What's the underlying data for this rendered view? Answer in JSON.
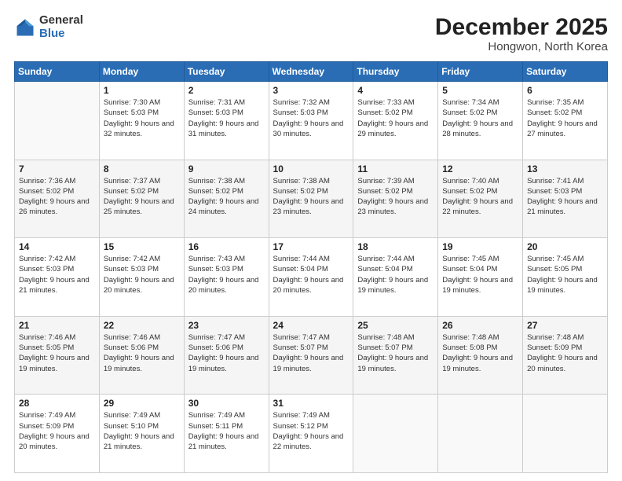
{
  "header": {
    "logo": {
      "general": "General",
      "blue": "Blue"
    },
    "month": "December 2025",
    "location": "Hongwon, North Korea"
  },
  "weekdays": [
    "Sunday",
    "Monday",
    "Tuesday",
    "Wednesday",
    "Thursday",
    "Friday",
    "Saturday"
  ],
  "weeks": [
    [
      {
        "day": "",
        "sunrise": "",
        "sunset": "",
        "daylight": ""
      },
      {
        "day": "1",
        "sunrise": "Sunrise: 7:30 AM",
        "sunset": "Sunset: 5:03 PM",
        "daylight": "Daylight: 9 hours and 32 minutes."
      },
      {
        "day": "2",
        "sunrise": "Sunrise: 7:31 AM",
        "sunset": "Sunset: 5:03 PM",
        "daylight": "Daylight: 9 hours and 31 minutes."
      },
      {
        "day": "3",
        "sunrise": "Sunrise: 7:32 AM",
        "sunset": "Sunset: 5:03 PM",
        "daylight": "Daylight: 9 hours and 30 minutes."
      },
      {
        "day": "4",
        "sunrise": "Sunrise: 7:33 AM",
        "sunset": "Sunset: 5:02 PM",
        "daylight": "Daylight: 9 hours and 29 minutes."
      },
      {
        "day": "5",
        "sunrise": "Sunrise: 7:34 AM",
        "sunset": "Sunset: 5:02 PM",
        "daylight": "Daylight: 9 hours and 28 minutes."
      },
      {
        "day": "6",
        "sunrise": "Sunrise: 7:35 AM",
        "sunset": "Sunset: 5:02 PM",
        "daylight": "Daylight: 9 hours and 27 minutes."
      }
    ],
    [
      {
        "day": "7",
        "sunrise": "Sunrise: 7:36 AM",
        "sunset": "Sunset: 5:02 PM",
        "daylight": "Daylight: 9 hours and 26 minutes."
      },
      {
        "day": "8",
        "sunrise": "Sunrise: 7:37 AM",
        "sunset": "Sunset: 5:02 PM",
        "daylight": "Daylight: 9 hours and 25 minutes."
      },
      {
        "day": "9",
        "sunrise": "Sunrise: 7:38 AM",
        "sunset": "Sunset: 5:02 PM",
        "daylight": "Daylight: 9 hours and 24 minutes."
      },
      {
        "day": "10",
        "sunrise": "Sunrise: 7:38 AM",
        "sunset": "Sunset: 5:02 PM",
        "daylight": "Daylight: 9 hours and 23 minutes."
      },
      {
        "day": "11",
        "sunrise": "Sunrise: 7:39 AM",
        "sunset": "Sunset: 5:02 PM",
        "daylight": "Daylight: 9 hours and 23 minutes."
      },
      {
        "day": "12",
        "sunrise": "Sunrise: 7:40 AM",
        "sunset": "Sunset: 5:02 PM",
        "daylight": "Daylight: 9 hours and 22 minutes."
      },
      {
        "day": "13",
        "sunrise": "Sunrise: 7:41 AM",
        "sunset": "Sunset: 5:03 PM",
        "daylight": "Daylight: 9 hours and 21 minutes."
      }
    ],
    [
      {
        "day": "14",
        "sunrise": "Sunrise: 7:42 AM",
        "sunset": "Sunset: 5:03 PM",
        "daylight": "Daylight: 9 hours and 21 minutes."
      },
      {
        "day": "15",
        "sunrise": "Sunrise: 7:42 AM",
        "sunset": "Sunset: 5:03 PM",
        "daylight": "Daylight: 9 hours and 20 minutes."
      },
      {
        "day": "16",
        "sunrise": "Sunrise: 7:43 AM",
        "sunset": "Sunset: 5:03 PM",
        "daylight": "Daylight: 9 hours and 20 minutes."
      },
      {
        "day": "17",
        "sunrise": "Sunrise: 7:44 AM",
        "sunset": "Sunset: 5:04 PM",
        "daylight": "Daylight: 9 hours and 20 minutes."
      },
      {
        "day": "18",
        "sunrise": "Sunrise: 7:44 AM",
        "sunset": "Sunset: 5:04 PM",
        "daylight": "Daylight: 9 hours and 19 minutes."
      },
      {
        "day": "19",
        "sunrise": "Sunrise: 7:45 AM",
        "sunset": "Sunset: 5:04 PM",
        "daylight": "Daylight: 9 hours and 19 minutes."
      },
      {
        "day": "20",
        "sunrise": "Sunrise: 7:45 AM",
        "sunset": "Sunset: 5:05 PM",
        "daylight": "Daylight: 9 hours and 19 minutes."
      }
    ],
    [
      {
        "day": "21",
        "sunrise": "Sunrise: 7:46 AM",
        "sunset": "Sunset: 5:05 PM",
        "daylight": "Daylight: 9 hours and 19 minutes."
      },
      {
        "day": "22",
        "sunrise": "Sunrise: 7:46 AM",
        "sunset": "Sunset: 5:06 PM",
        "daylight": "Daylight: 9 hours and 19 minutes."
      },
      {
        "day": "23",
        "sunrise": "Sunrise: 7:47 AM",
        "sunset": "Sunset: 5:06 PM",
        "daylight": "Daylight: 9 hours and 19 minutes."
      },
      {
        "day": "24",
        "sunrise": "Sunrise: 7:47 AM",
        "sunset": "Sunset: 5:07 PM",
        "daylight": "Daylight: 9 hours and 19 minutes."
      },
      {
        "day": "25",
        "sunrise": "Sunrise: 7:48 AM",
        "sunset": "Sunset: 5:07 PM",
        "daylight": "Daylight: 9 hours and 19 minutes."
      },
      {
        "day": "26",
        "sunrise": "Sunrise: 7:48 AM",
        "sunset": "Sunset: 5:08 PM",
        "daylight": "Daylight: 9 hours and 19 minutes."
      },
      {
        "day": "27",
        "sunrise": "Sunrise: 7:48 AM",
        "sunset": "Sunset: 5:09 PM",
        "daylight": "Daylight: 9 hours and 20 minutes."
      }
    ],
    [
      {
        "day": "28",
        "sunrise": "Sunrise: 7:49 AM",
        "sunset": "Sunset: 5:09 PM",
        "daylight": "Daylight: 9 hours and 20 minutes."
      },
      {
        "day": "29",
        "sunrise": "Sunrise: 7:49 AM",
        "sunset": "Sunset: 5:10 PM",
        "daylight": "Daylight: 9 hours and 21 minutes."
      },
      {
        "day": "30",
        "sunrise": "Sunrise: 7:49 AM",
        "sunset": "Sunset: 5:11 PM",
        "daylight": "Daylight: 9 hours and 21 minutes."
      },
      {
        "day": "31",
        "sunrise": "Sunrise: 7:49 AM",
        "sunset": "Sunset: 5:12 PM",
        "daylight": "Daylight: 9 hours and 22 minutes."
      },
      {
        "day": "",
        "sunrise": "",
        "sunset": "",
        "daylight": ""
      },
      {
        "day": "",
        "sunrise": "",
        "sunset": "",
        "daylight": ""
      },
      {
        "day": "",
        "sunrise": "",
        "sunset": "",
        "daylight": ""
      }
    ]
  ]
}
